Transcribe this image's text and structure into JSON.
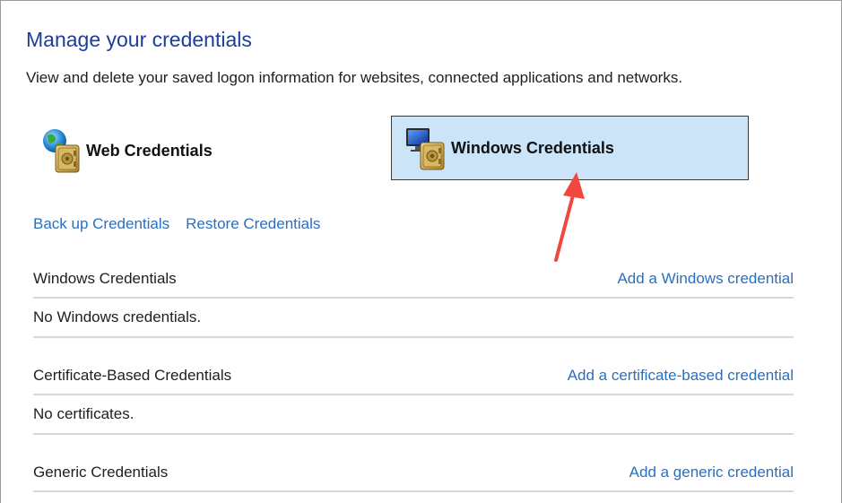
{
  "header": {
    "title": "Manage your credentials",
    "description": "View and delete your saved logon information for websites, connected applications and networks."
  },
  "tiles": {
    "web": {
      "label": "Web Credentials",
      "icon": "globe-vault-icon"
    },
    "windows": {
      "label": "Windows Credentials",
      "icon": "monitor-vault-icon",
      "selected": true
    }
  },
  "actions": {
    "backup": "Back up Credentials",
    "restore": "Restore Credentials"
  },
  "sections": [
    {
      "title": "Windows Credentials",
      "action": "Add a Windows credential",
      "empty_text": "No Windows credentials."
    },
    {
      "title": "Certificate-Based Credentials",
      "action": "Add a certificate-based credential",
      "empty_text": "No certificates."
    },
    {
      "title": "Generic Credentials",
      "action": "Add a generic credential"
    }
  ],
  "colors": {
    "title_blue": "#1c3d9c",
    "link_blue": "#2a6fc0",
    "selected_tile": "#cce4f7",
    "annotation_arrow": "#f0483e"
  }
}
